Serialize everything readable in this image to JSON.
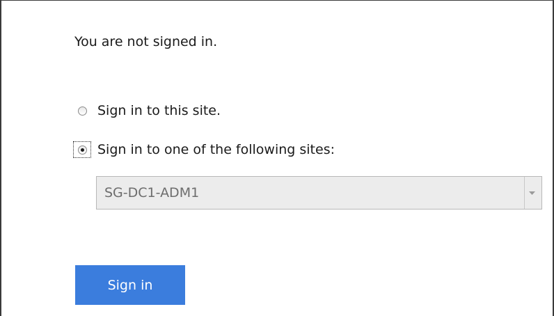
{
  "status_message": "You are not signed in.",
  "options": [
    {
      "label": "Sign in to this site.",
      "selected": false
    },
    {
      "label": "Sign in to one of the following sites:",
      "selected": true
    }
  ],
  "site_select": {
    "value": "SG-DC1-ADM1",
    "disabled": true
  },
  "sign_in_button": {
    "label": "Sign in",
    "color": "#3b7ddd"
  },
  "icons": {
    "select_arrow": "chevron-down-icon"
  }
}
